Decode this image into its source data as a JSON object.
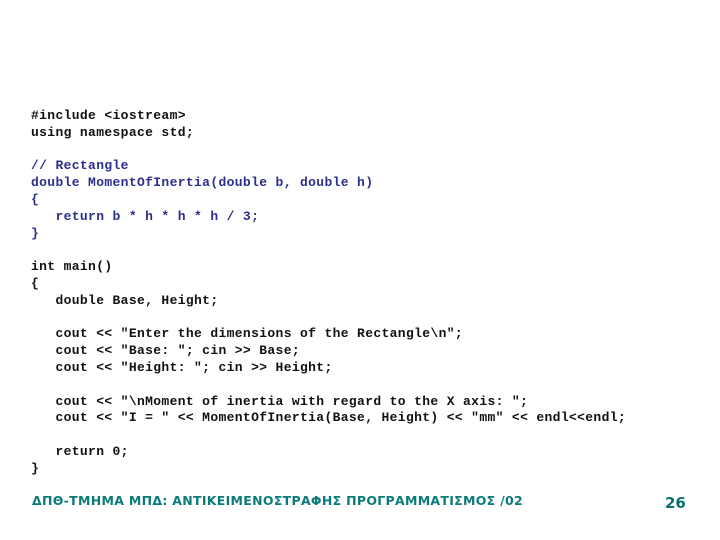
{
  "slide": {
    "code_lines": [
      {
        "text": "#include <iostream>",
        "color": "black"
      },
      {
        "text": "using namespace std;",
        "color": "black"
      },
      {
        "text": "",
        "color": "black"
      },
      {
        "text": "// Rectangle",
        "color": "blue"
      },
      {
        "text": "double MomentOfInertia(double b, double h)",
        "color": "blue"
      },
      {
        "text": "{",
        "color": "blue"
      },
      {
        "text": "   return b * h * h * h / 3;",
        "color": "blue"
      },
      {
        "text": "}",
        "color": "blue"
      },
      {
        "text": "",
        "color": "black"
      },
      {
        "text": "int main()",
        "color": "black"
      },
      {
        "text": "{",
        "color": "black"
      },
      {
        "text": "   double Base, Height;",
        "color": "black"
      },
      {
        "text": "",
        "color": "black"
      },
      {
        "text": "   cout << \"Enter the dimensions of the Rectangle\\n\";",
        "color": "black"
      },
      {
        "text": "   cout << \"Base: \"; cin >> Base;",
        "color": "black"
      },
      {
        "text": "   cout << \"Height: \"; cin >> Height;",
        "color": "black"
      },
      {
        "text": "",
        "color": "black"
      },
      {
        "text": "   cout << \"\\nMoment of inertia with regard to the X axis: \";",
        "color": "black"
      },
      {
        "text": "   cout << \"I = \" << MomentOfInertia(Base, Height) << \"mm\" << endl<<endl;",
        "color": "black"
      },
      {
        "text": "",
        "color": "black"
      },
      {
        "text": "   return 0;",
        "color": "black"
      },
      {
        "text": "}",
        "color": "black"
      }
    ],
    "footer": "ΔΠΘ-ΤΜΗΜΑ ΜΠΔ: ΑΝΤΙΚΕΙΜΕΝΟΣΤΡΑΦΗΣ ΠΡΟΓΡΑΜΜΑΤΙΣΜΟΣ /02",
    "page_number": "26",
    "colors": {
      "code_black": "#111111",
      "code_blue": "#2b2f8c",
      "footer_teal": "#0b7a7a"
    }
  }
}
